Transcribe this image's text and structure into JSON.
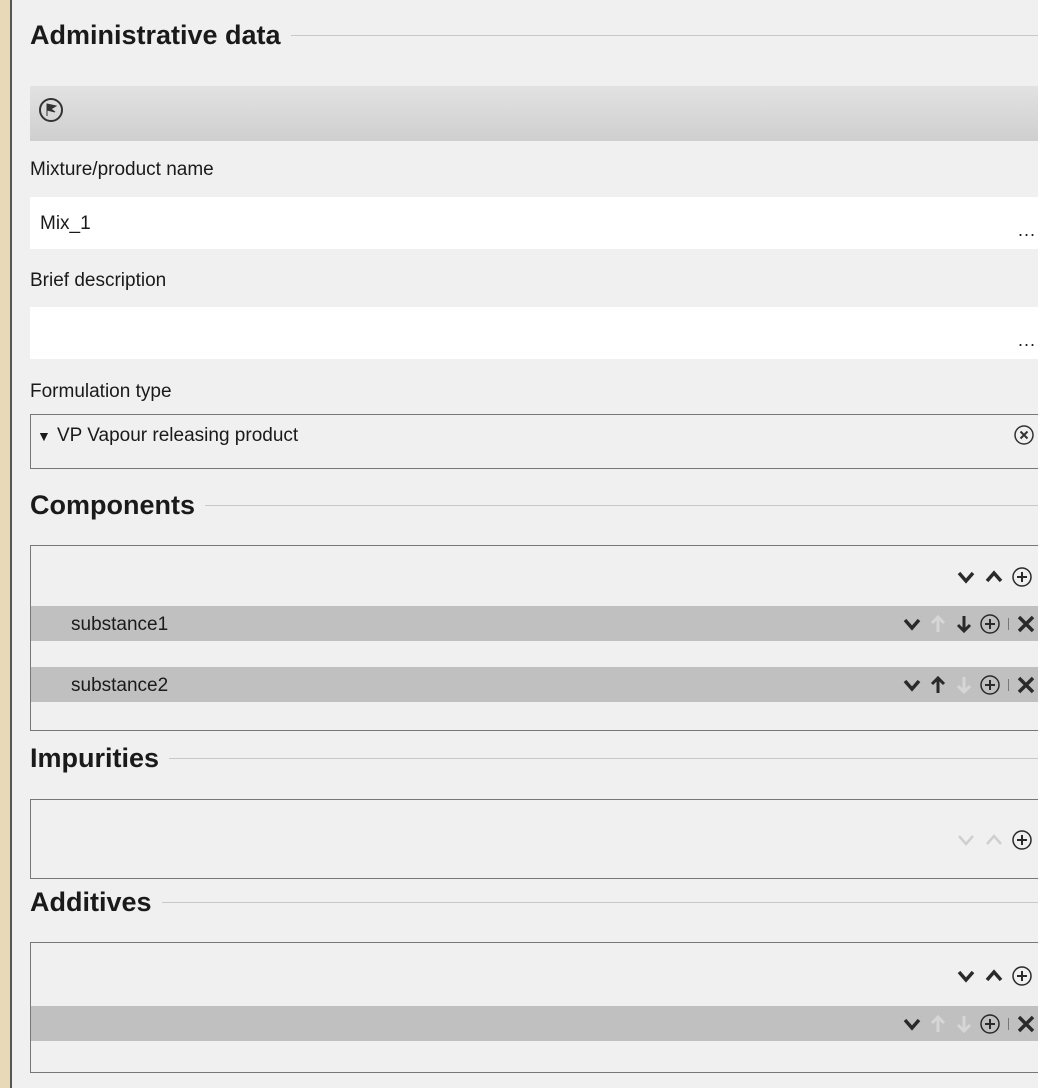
{
  "administrative": {
    "title": "Administrative data",
    "mixture_label": "Mixture/product name",
    "mixture_value": "Mix_1",
    "brief_label": "Brief description",
    "brief_value": "",
    "formulation_label": "Formulation type",
    "formulation_value": "VP Vapour releasing product",
    "more_glyph": "..."
  },
  "components": {
    "title": "Components",
    "rows": [
      {
        "name": "substance1",
        "up_enabled": false,
        "down_enabled": true
      },
      {
        "name": "substance2",
        "up_enabled": true,
        "down_enabled": false
      }
    ]
  },
  "impurities": {
    "title": "Impurities",
    "controls_enabled": false
  },
  "additives": {
    "title": "Additives",
    "rows": [
      {
        "name": "",
        "up_enabled": false,
        "down_enabled": false
      }
    ]
  },
  "icons": [
    "flag-icon",
    "clear-icon",
    "chevron-down-icon",
    "chevron-up-icon",
    "arrow-up-icon",
    "arrow-down-icon",
    "add-circle-icon",
    "delete-icon"
  ],
  "colors": {
    "enabled": "#2a2a2a",
    "disabled": "#c8c8c8",
    "row_bg": "#c0c0c0"
  }
}
